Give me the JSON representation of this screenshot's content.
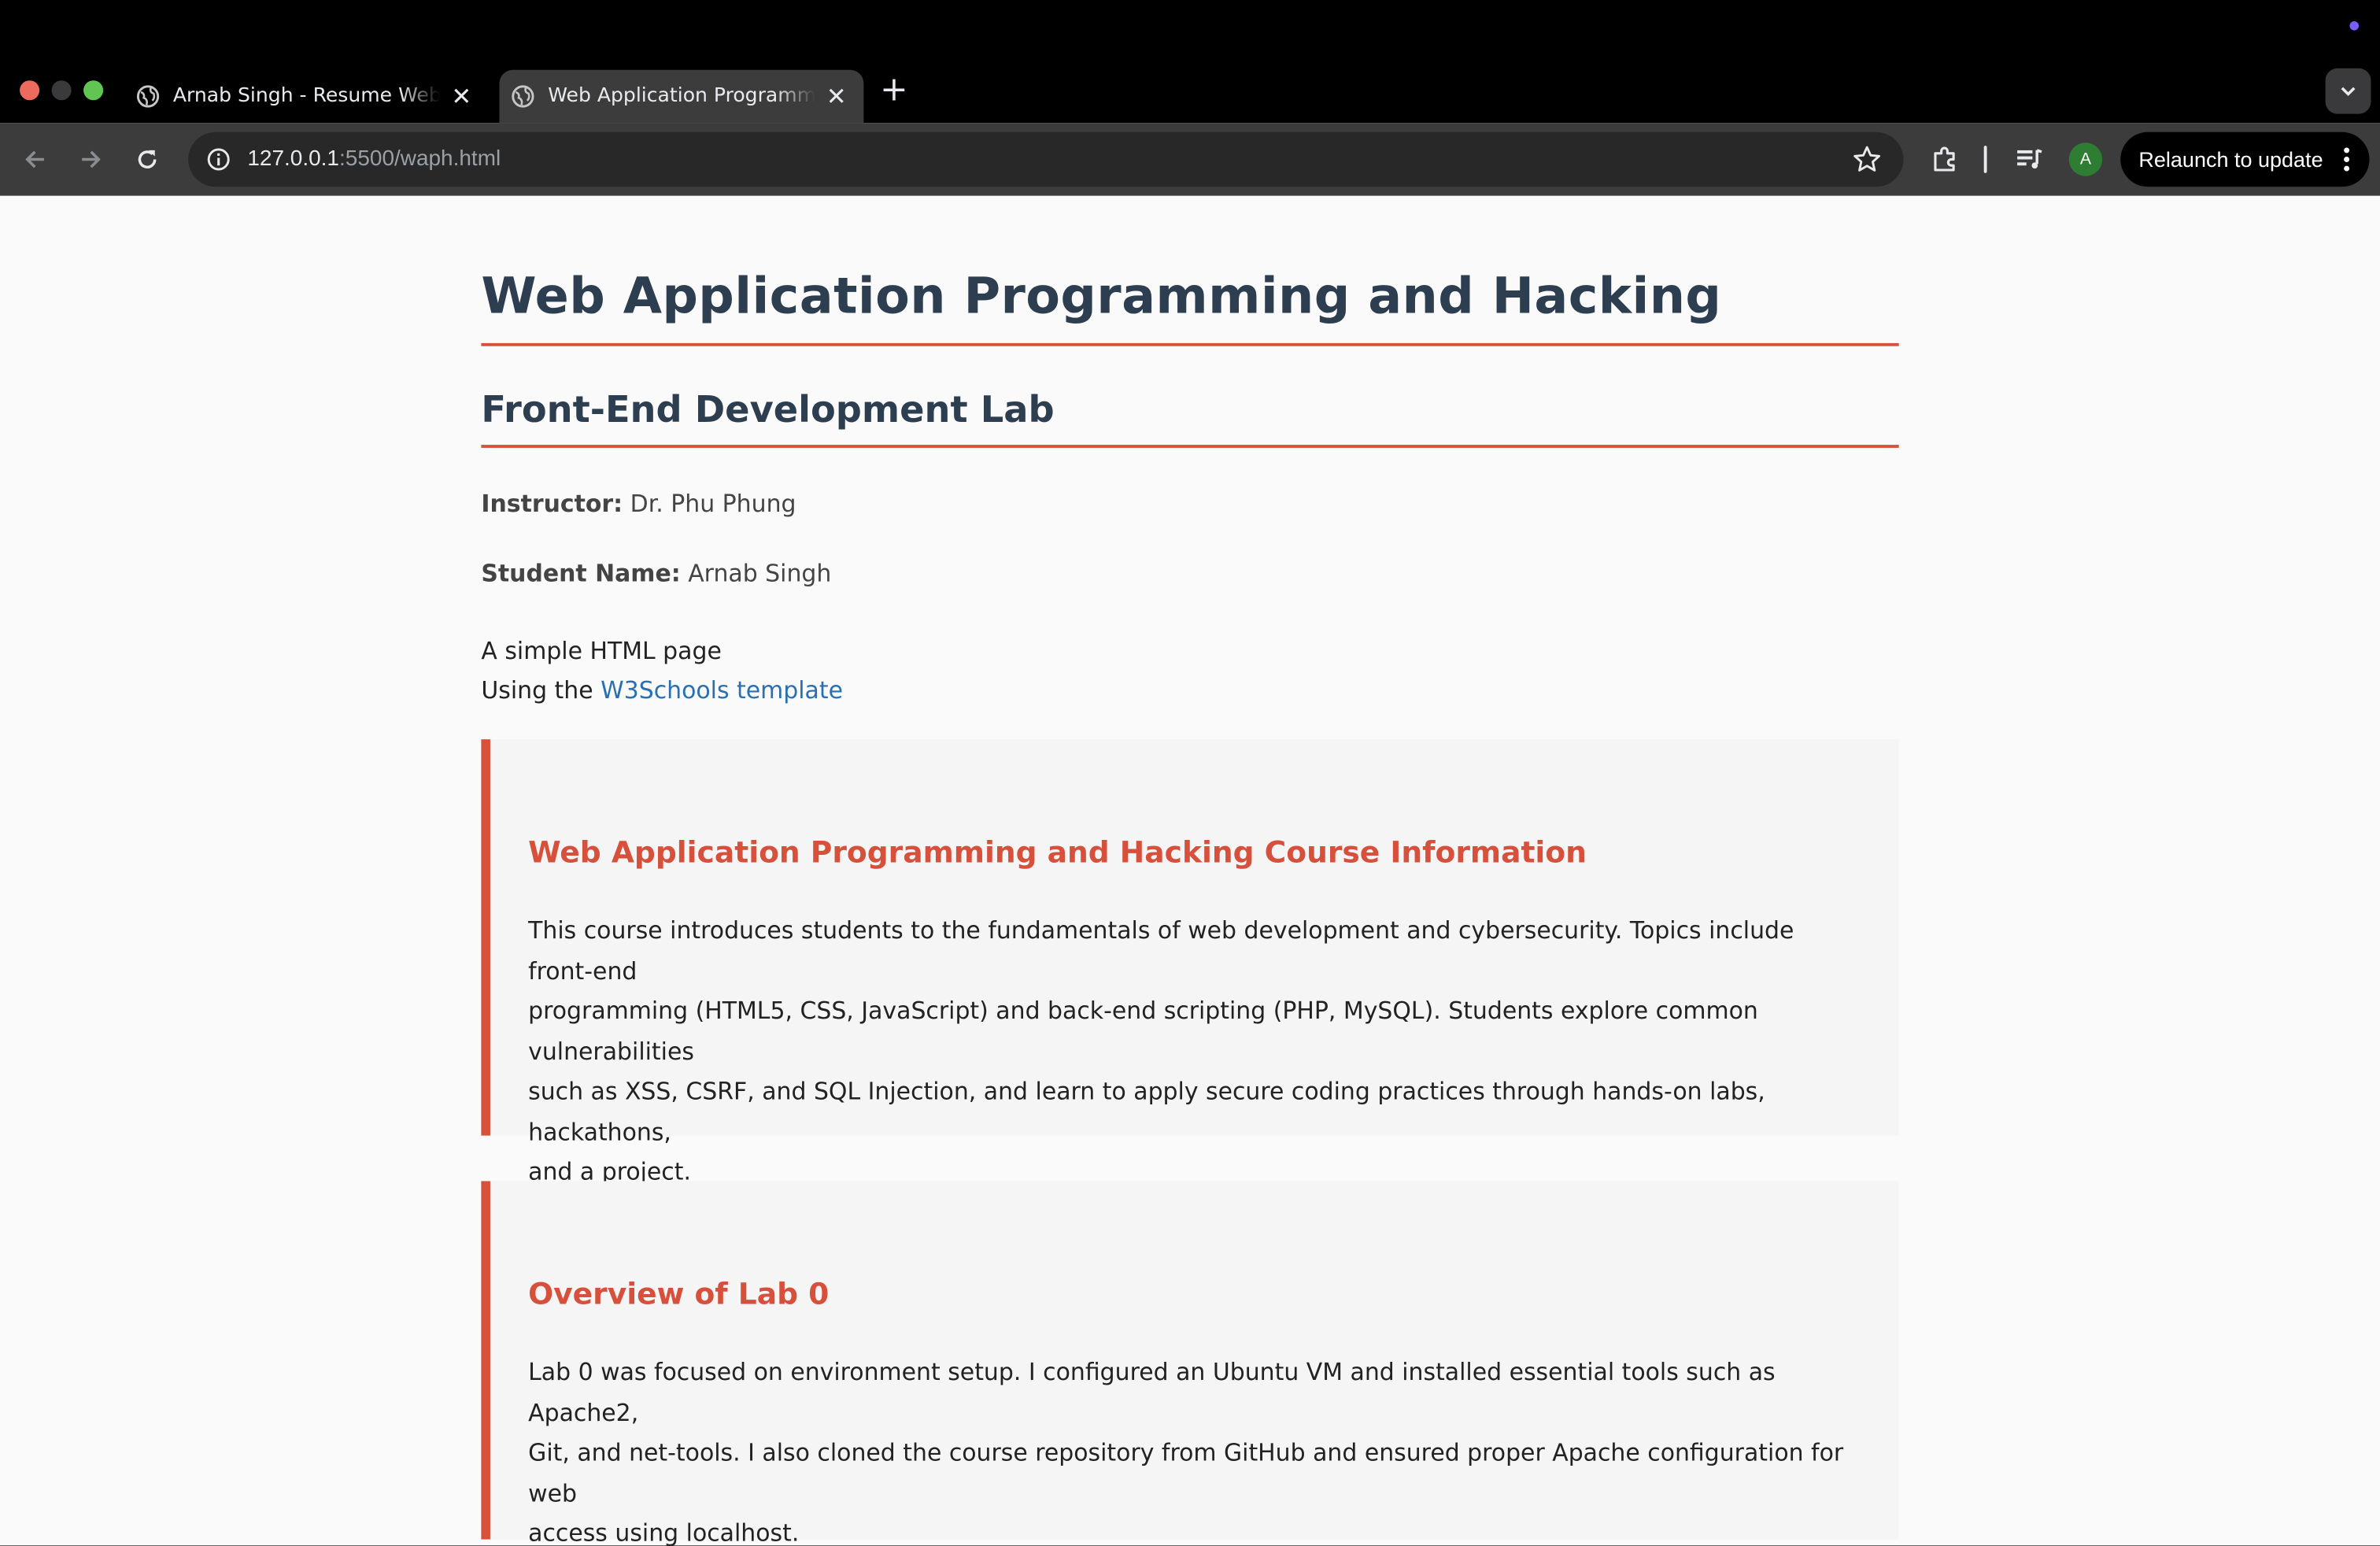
{
  "browser": {
    "tabs": [
      {
        "title": "Arnab Singh - Resume Website",
        "active": false
      },
      {
        "title": "Web Application Programming and Hacking",
        "active": true
      }
    ],
    "address": {
      "host": "127.0.0.1",
      "path": ":5500/waph.html"
    },
    "profile_initial": "A",
    "relaunch_label": "Relaunch to update"
  },
  "page": {
    "title": "Web Application Programming and Hacking",
    "subtitle": "Front-End Development Lab",
    "instructor_label": "Instructor:",
    "instructor": "Dr. Phu Phung",
    "student_label": "Student Name:",
    "student": "Arnab Singh",
    "intro_line1": "A simple HTML page",
    "intro_line2_prefix": "Using the",
    "intro_link": "W3Schools template",
    "sections": [
      {
        "heading": "Web Application Programming and Hacking Course Information",
        "lines": [
          "This course introduces students to the fundamentals of web development and cybersecurity. Topics include front-end",
          "programming (HTML5, CSS, JavaScript) and back-end scripting (PHP, MySQL). Students explore common vulnerabilities",
          "such as XSS, CSRF, and SQL Injection, and learn to apply secure coding practices through hands-on labs, hackathons,",
          "and a project."
        ]
      },
      {
        "heading": "Overview of Lab 0",
        "lines": [
          "Lab 0 was focused on environment setup. I configured an Ubuntu VM and installed essential tools such as Apache2,",
          "Git, and net-tools. I also cloned the course repository from GitHub and ensured proper Apache configuration for web",
          "access using localhost."
        ]
      }
    ]
  }
}
